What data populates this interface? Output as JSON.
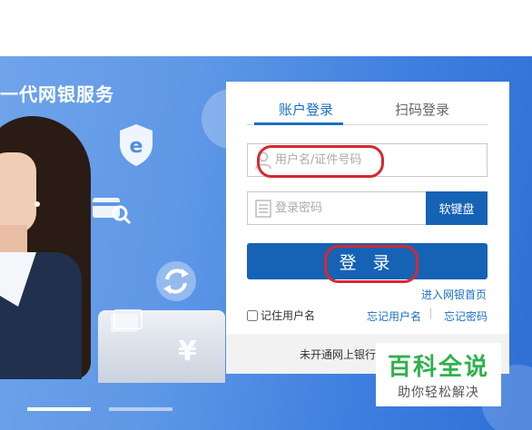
{
  "banner": {
    "slogan": "一代网银服务",
    "yen_symbol": "¥"
  },
  "login": {
    "tabs": [
      {
        "label": "账户登录",
        "active": true
      },
      {
        "label": "扫码登录",
        "active": false
      }
    ],
    "username_placeholder": "用户名/证件号码",
    "password_placeholder": "登录密码",
    "soft_keyboard_label": "软键盘",
    "login_button_label": "登 录",
    "enter_bank_home": "进入网银首页",
    "remember_username": "记住用户名",
    "forgot_username": "忘记用户名",
    "forgot_password": "忘记密码",
    "footer_text": "未开通网上银行"
  },
  "watermark": {
    "title": "百科全说",
    "subtitle": "助你轻松解决"
  },
  "colors": {
    "primary": "#1662b5",
    "annotation": "#d8272f",
    "watermark_green": "#2fb14b"
  }
}
